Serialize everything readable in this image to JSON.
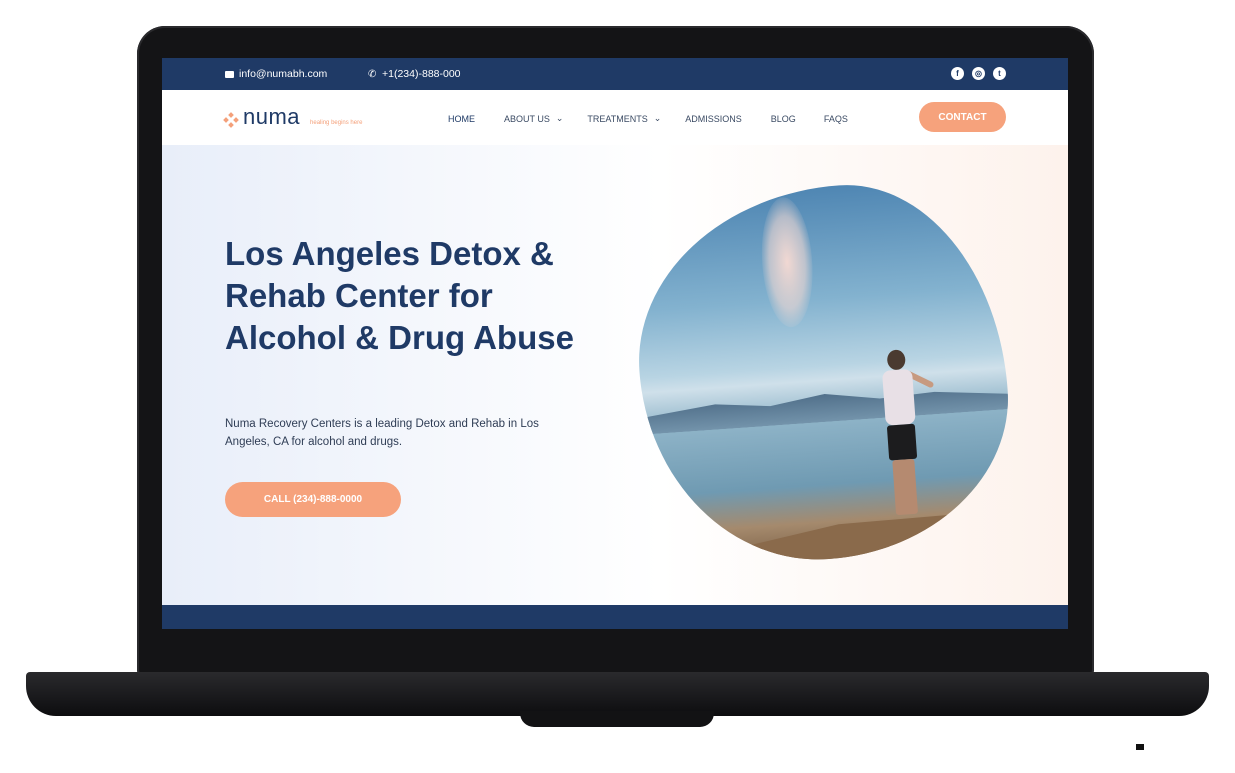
{
  "topbar": {
    "email": "info@numabh.com",
    "phone": "+1(234)-888-000",
    "social": [
      "facebook-icon",
      "instagram-icon",
      "twitter-icon"
    ]
  },
  "nav": {
    "logo": "numa",
    "tagline": "healing begins here",
    "menu": [
      {
        "label": "HOME",
        "has_dropdown": false
      },
      {
        "label": "ABOUT US",
        "has_dropdown": true
      },
      {
        "label": "TREATMENTS",
        "has_dropdown": true
      },
      {
        "label": "ADMISSIONS",
        "has_dropdown": false
      },
      {
        "label": "BLOG",
        "has_dropdown": false
      },
      {
        "label": "FAQS",
        "has_dropdown": false
      }
    ],
    "contact_label": "CONTACT"
  },
  "hero": {
    "heading": "Los Angeles Detox & Rehab Center for Alcohol & Drug Abuse",
    "description": "Numa Recovery Centers is a leading Detox and Rehab in Los Angeles, CA for alcohol and drugs.",
    "cta_label": "CALL (234)-888-0000"
  },
  "colors": {
    "navy": "#1f3a66",
    "accent": "#f6a27c"
  }
}
